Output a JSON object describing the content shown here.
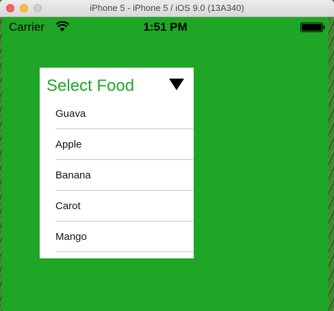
{
  "window": {
    "title": "iPhone 5 - iPhone 5 / iOS 9.0 (13A340)"
  },
  "statusbar": {
    "carrier": "Carrier",
    "time": "1:51 PM",
    "wifi_icon": "wifi-icon",
    "battery_icon": "battery-icon",
    "battery_level": 1.0
  },
  "dropdown": {
    "title": "Select Food",
    "toggle_icon": "triangle-down-icon",
    "options": [
      {
        "label": "Guava"
      },
      {
        "label": "Apple"
      },
      {
        "label": "Banana"
      },
      {
        "label": "Carot"
      },
      {
        "label": "Mango"
      }
    ]
  },
  "colors": {
    "screen_background": "#1fa626",
    "accent_text": "#1fa626",
    "dropdown_background": "#ffffff"
  }
}
